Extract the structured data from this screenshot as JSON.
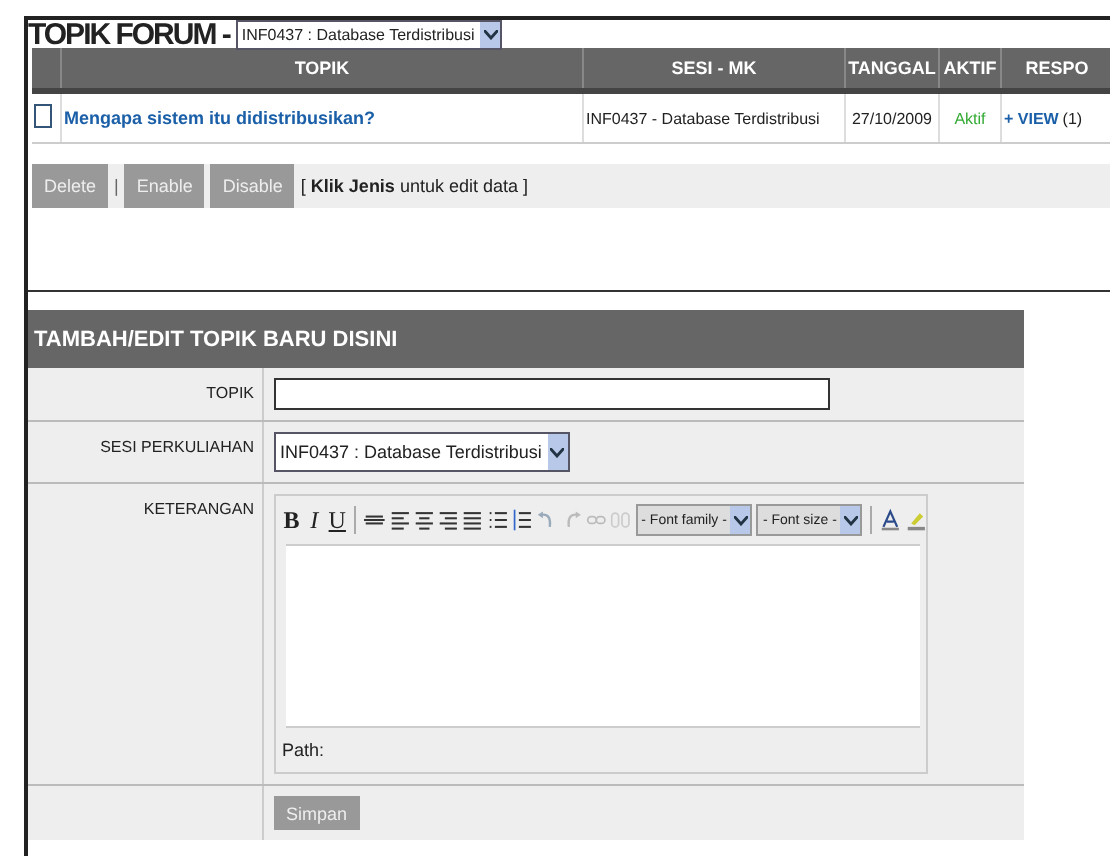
{
  "title": "TOPIK FORUM -",
  "course_select": {
    "value": "INF0437 : Database Terdistribusi"
  },
  "table": {
    "columns": [
      "TOPIK",
      "SESI - MK",
      "TANGGAL",
      "AKTIF",
      "RESPO"
    ],
    "rows": [
      {
        "checked": false,
        "topic": "Mengapa sistem itu didistribusikan?",
        "session": "INF0437 - Database Terdistribusi",
        "date": "27/10/2009",
        "status": "Aktif",
        "view": "+ VIEW",
        "count": "(1)"
      }
    ]
  },
  "actions_separator": "|",
  "actions": [
    {
      "label": "Delete"
    },
    {
      "label": "Enable"
    },
    {
      "label": "Disable"
    }
  ],
  "hint": "[ **Klik Jenis** untuk edit data ]",
  "form": {
    "title": "TAMBAH/EDIT TOPIK BARU DISINI",
    "topic_label": "TOPIK",
    "session_label": "SESI PERKULIAHAN",
    "session_value": "INF0437 : Database Terdistribusi",
    "description_label": "KETERANGAN",
    "toolbar": {
      "bold": "B",
      "italic": "I",
      "underline": "U",
      "font_family": "- Font family -",
      "font_size": "- Font size -"
    },
    "path": "Path:",
    "submit": "Simpan"
  }
}
